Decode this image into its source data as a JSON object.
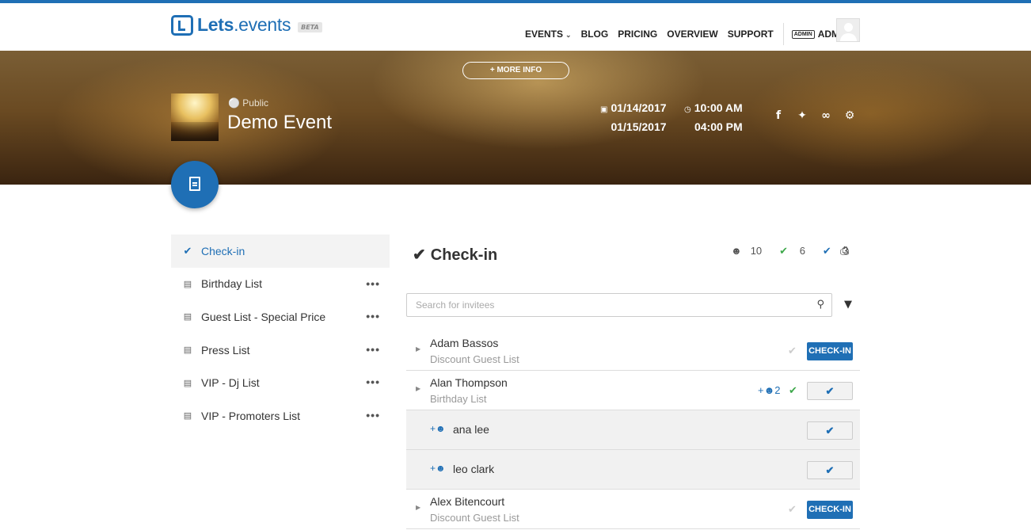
{
  "header": {
    "logo_bold": "Lets",
    "logo_rest": ".events",
    "beta": "BETA",
    "nav": {
      "events": "EVENTS",
      "blog": "BLOG",
      "pricing": "PRICING",
      "overview": "OVERVIEW",
      "support": "SUPPORT"
    },
    "admin_badge": "ADMIN",
    "admin_name": "ADMIN"
  },
  "banner": {
    "more_info": "+ MORE INFO",
    "visibility": "Public",
    "event_title": "Demo Event",
    "start_date": "01/14/2017",
    "end_date": "01/15/2017",
    "start_time": "10:00 AM",
    "end_time": "04:00 PM"
  },
  "sidebar": {
    "items": [
      {
        "label": "Check-in"
      },
      {
        "label": "Birthday List"
      },
      {
        "label": "Guest List - Special Price"
      },
      {
        "label": "Press List"
      },
      {
        "label": "VIP - Dj List"
      },
      {
        "label": "VIP - Promoters List"
      }
    ],
    "more": "•••"
  },
  "main": {
    "title": "Check-in",
    "stats": {
      "total": "10",
      "checked": "6",
      "blue": "3"
    },
    "search_placeholder": "Search for invitees",
    "checkin_label": "CHECK-IN",
    "rows": [
      {
        "name": "Adam Bassos",
        "list": "Discount Guest List"
      },
      {
        "name": "Alan Thompson",
        "list": "Birthday List",
        "plus": "2"
      },
      {
        "name": "ana lee"
      },
      {
        "name": "leo clark"
      },
      {
        "name": "Alex Bitencourt",
        "list": "Discount Guest List"
      }
    ]
  },
  "colors": {
    "accent": "#1f6fb5",
    "success": "#3ea84b"
  }
}
